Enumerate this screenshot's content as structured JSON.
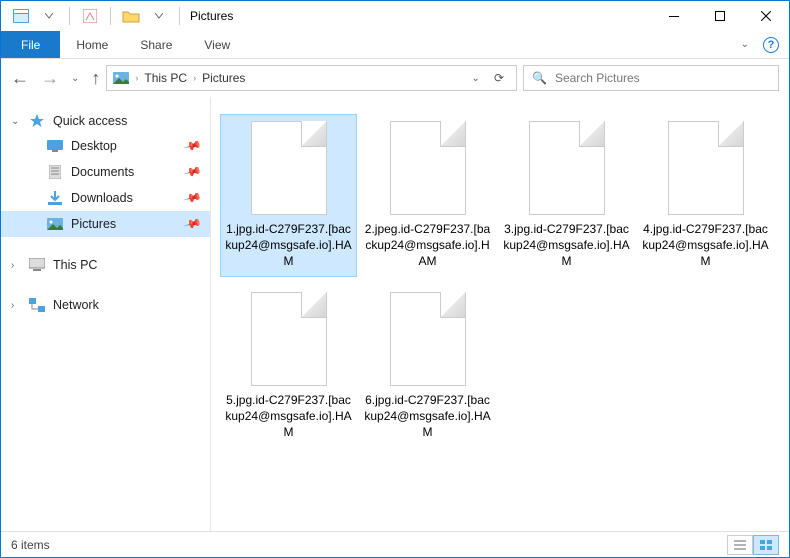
{
  "title": "Pictures",
  "ribbon": {
    "file": "File",
    "tabs": [
      "Home",
      "Share",
      "View"
    ]
  },
  "breadcrumb": {
    "root": "This PC",
    "current": "Pictures"
  },
  "search": {
    "placeholder": "Search Pictures"
  },
  "sidebar": {
    "quick_access": "Quick access",
    "items": [
      {
        "label": "Desktop",
        "icon": "desktop"
      },
      {
        "label": "Documents",
        "icon": "documents"
      },
      {
        "label": "Downloads",
        "icon": "downloads"
      },
      {
        "label": "Pictures",
        "icon": "pictures",
        "selected": true
      }
    ],
    "this_pc": "This PC",
    "network": "Network"
  },
  "files": [
    {
      "name": "1.jpg.id-C279F237.[backup24@msgsafe.io].HAM",
      "selected": true
    },
    {
      "name": "2.jpeg.id-C279F237.[backup24@msgsafe.io].HAM"
    },
    {
      "name": "3.jpg.id-C279F237.[backup24@msgsafe.io].HAM"
    },
    {
      "name": "4.jpg.id-C279F237.[backup24@msgsafe.io].HAM"
    },
    {
      "name": "5.jpg.id-C279F237.[backup24@msgsafe.io].HAM"
    },
    {
      "name": "6.jpg.id-C279F237.[backup24@msgsafe.io].HAM"
    }
  ],
  "status": {
    "count_label": "6 items"
  }
}
